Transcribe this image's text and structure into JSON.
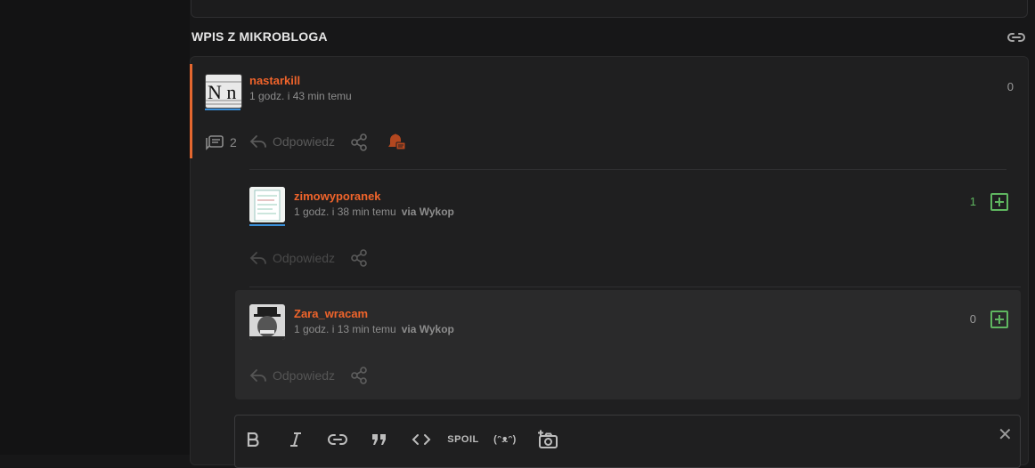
{
  "section": {
    "title": "WPIS Z MIKROBLOGA",
    "link_icon": "link-icon"
  },
  "entry": {
    "author": "nastarkill",
    "avatar_text": "N n",
    "time": "1 godz. i 43 min temu",
    "score": "0",
    "comments_count": "2",
    "reply_label": "Odpowiedz",
    "accent_color": "#e4672f",
    "username_color": "#f0642b"
  },
  "comments": [
    {
      "author": "zimowyporanek",
      "time": "1 godz. i 38 min temu",
      "via": "via Wykop",
      "score": "1",
      "reply_label": "Odpowiedz"
    },
    {
      "author": "Zara_wracam",
      "time": "1 godz. i 13 min temu",
      "via": "via Wykop",
      "score": "0",
      "reply_label": "Odpowiedz"
    }
  ],
  "editor": {
    "tools": [
      "bold-icon",
      "italic-icon",
      "link-icon",
      "quote-icon",
      "code-icon",
      "spoiler",
      "lenny-face",
      "camera-icon"
    ],
    "spoiler_label": "SPOIL",
    "lenny_label": "(ᵔᴥᵔ)",
    "close_label": "✕"
  }
}
